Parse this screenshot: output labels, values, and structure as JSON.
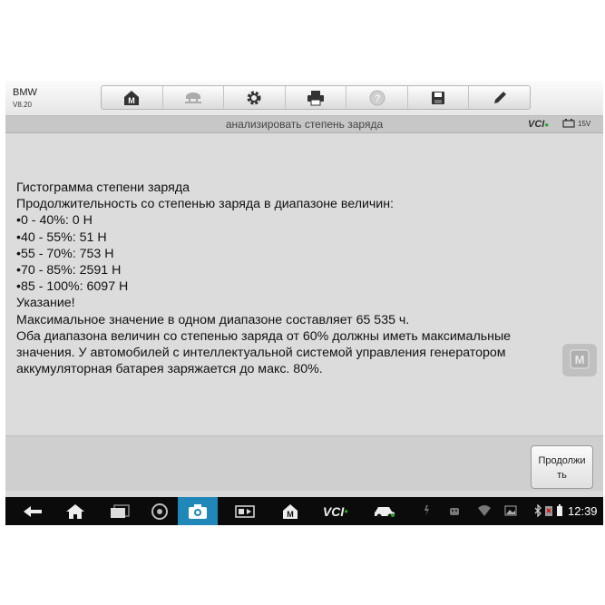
{
  "app": {
    "brand": "BMW",
    "version": "V8.20"
  },
  "toolbar": {
    "buttons": [
      {
        "icon": "home-m-icon"
      },
      {
        "icon": "car-lift-icon"
      },
      {
        "icon": "gear-icon"
      },
      {
        "icon": "printer-icon"
      },
      {
        "icon": "help-icon"
      },
      {
        "icon": "save-icon"
      },
      {
        "icon": "pen-icon"
      }
    ]
  },
  "titlebar": {
    "title": "анализировать степень заряда",
    "vci": "VCI",
    "battery_voltage": "15V"
  },
  "content": {
    "lines": [
      "Гистограмма степени заряда",
      "Продолжительность со степенью заряда в диапазоне величин:",
      "•0 - 40%: 0 Н",
      "•40 - 55%: 51 Н",
      "•55 - 70%: 753 Н",
      "•70 - 85%: 2591 Н",
      "•85 - 100%: 6097 Н",
      "Указание!",
      "Максимальное значение в одном диапазоне составляет 65 535 ч.",
      "Оба диапазона величин со степенью заряда от 60% должны иметь максимальные",
      "значения. У автомобилей с интеллектуальной системой управления генератором",
      "аккумуляторная батарея заряжается до макс. 80%."
    ]
  },
  "footer": {
    "continue_label": "Продолжить"
  },
  "navbar": {
    "clock": "12:39",
    "vci_label": "VCI"
  },
  "colors": {
    "accent_camera": "#1f88b8",
    "vci_dot": "#28a428"
  }
}
